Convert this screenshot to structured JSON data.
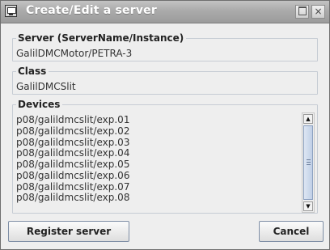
{
  "window": {
    "title": "Create/Edit a server",
    "app_icon": "terminal-icon",
    "controls": {
      "maximize": "maximize-icon",
      "close": "×"
    }
  },
  "server": {
    "label": "Server  (ServerName/Instance)",
    "value": "GalilDMCMotor/PETRA-3"
  },
  "class": {
    "label": "Class",
    "value": "GalilDMCSlit"
  },
  "devices": {
    "label": "Devices",
    "items": [
      "p08/galildmcslit/exp.01",
      "p08/galildmcslit/exp.02",
      "p08/galildmcslit/exp.03",
      "p08/galildmcslit/exp.04",
      "p08/galildmcslit/exp.05",
      "p08/galildmcslit/exp.06",
      "p08/galildmcslit/exp.07",
      "p08/galildmcslit/exp.08"
    ],
    "scroll_up": "▲",
    "scroll_down": "▼"
  },
  "buttons": {
    "register": "Register server",
    "cancel": "Cancel"
  }
}
